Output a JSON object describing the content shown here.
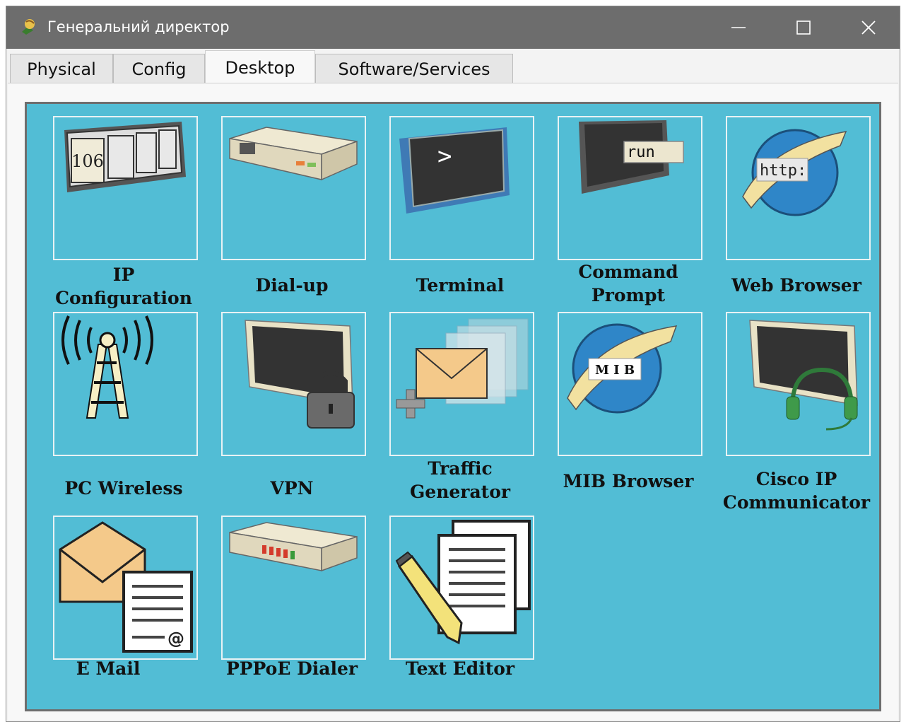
{
  "window": {
    "title": "Генеральний директор",
    "controls": {
      "minimize": "—",
      "maximize": "☐",
      "close": "✕"
    }
  },
  "tabs": [
    {
      "label": "Physical",
      "active": false
    },
    {
      "label": "Config",
      "active": false
    },
    {
      "label": "Desktop",
      "active": true
    },
    {
      "label": "Software/Services",
      "active": false
    }
  ],
  "desktop": {
    "background_color": "#52bdd5",
    "apps": [
      {
        "label_line1": "IP",
        "label_line2": "Configuration",
        "icon": "ip-configuration-icon",
        "icon_text": "106"
      },
      {
        "label_line1": "Dial-up",
        "label_line2": "",
        "icon": "modem-icon"
      },
      {
        "label_line1": "Terminal",
        "label_line2": "",
        "icon": "terminal-icon",
        "icon_text": ">"
      },
      {
        "label_line1": "Command",
        "label_line2": "Prompt",
        "icon": "command-prompt-icon",
        "icon_text": "run"
      },
      {
        "label_line1": "Web Browser",
        "label_line2": "",
        "icon": "web-browser-icon",
        "icon_text": "http:"
      },
      {
        "label_line1": "PC Wireless",
        "label_line2": "",
        "icon": "wireless-tower-icon"
      },
      {
        "label_line1": "VPN",
        "label_line2": "",
        "icon": "vpn-lock-icon"
      },
      {
        "label_line1": "Traffic",
        "label_line2": "Generator",
        "icon": "traffic-generator-icon"
      },
      {
        "label_line1": "MIB Browser",
        "label_line2": "",
        "icon": "mib-browser-icon",
        "icon_text": "M I B"
      },
      {
        "label_line1": "Cisco IP",
        "label_line2": "Communicator",
        "icon": "ip-communicator-icon"
      },
      {
        "label_line1": "E Mail",
        "label_line2": "",
        "icon": "email-icon",
        "icon_text": "@"
      },
      {
        "label_line1": "PPPoE Dialer",
        "label_line2": "",
        "icon": "pppoe-dialer-icon"
      },
      {
        "label_line1": "Text Editor",
        "label_line2": "",
        "icon": "text-editor-icon"
      }
    ]
  }
}
